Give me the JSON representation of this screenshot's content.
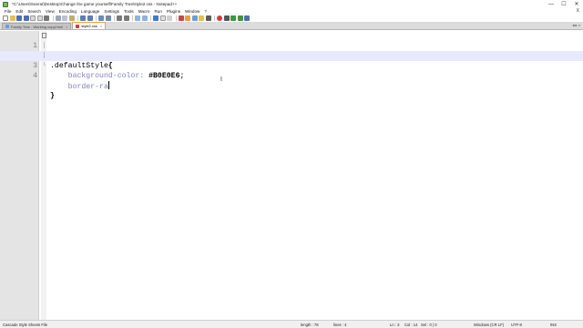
{
  "window": {
    "title": "*C:\\Users\\Seerat\\Desktop\\Change the game yourself\\Family Tree\\style2.css - Notepad++",
    "controls": [
      "—",
      "☐",
      "✕"
    ]
  },
  "menu": {
    "items": [
      "File",
      "Edit",
      "Search",
      "View",
      "Encoding",
      "Language",
      "Settings",
      "Tools",
      "Macro",
      "Run",
      "Plugins",
      "Window",
      "?"
    ],
    "right": "X"
  },
  "toolbar": {
    "icons": [
      "new-file-icon",
      "open-file-icon",
      "save-icon",
      "save-all-icon",
      "close-icon",
      "close-all-icon",
      "print-icon",
      "cut-icon",
      "copy-icon",
      "paste-icon",
      "undo-icon",
      "redo-icon",
      "find-icon",
      "replace-icon",
      "zoom-in-icon",
      "zoom-out-icon",
      "sync-v-icon",
      "sync-h-icon",
      "wrap-icon",
      "all-chars-icon",
      "indent-guide-icon",
      "lang-icon",
      "doc-map-icon",
      "function-list-icon",
      "folder-workspace-icon",
      "monitor-icon",
      "record-macro-icon",
      "stop-record-icon",
      "play-macro-icon",
      "run-macro-icon",
      "save-macro-icon"
    ]
  },
  "tabs": [
    {
      "label": "Family Tree - Working copy.html",
      "active": false
    },
    {
      "label": "style2.css",
      "active": true
    }
  ],
  "editor": {
    "lines": [
      {
        "num": "1",
        "selector": ".defaultStyle",
        "brace": "{"
      },
      {
        "num": "2",
        "property": "background-color:",
        "value": "#B0E0E6",
        "end": ";"
      },
      {
        "num": "3",
        "typed": "border-ra"
      },
      {
        "num": "4",
        "brace": "}"
      }
    ]
  },
  "status": {
    "file_type": "Cascade Style Sheets File",
    "length": "length : 78",
    "lines": "lines : 4",
    "ln": "Ln : 3",
    "col": "Col : 14",
    "sel": "Sel : 0 | 0",
    "eol": "Windows (CR LF)",
    "encoding": "UTF-8",
    "mode": "INS"
  },
  "colors": {
    "current_line": "#e8e8ff",
    "property": "#8080c0",
    "gutter": "#e4e4e4",
    "active_tab_accent": "#f7a030"
  }
}
